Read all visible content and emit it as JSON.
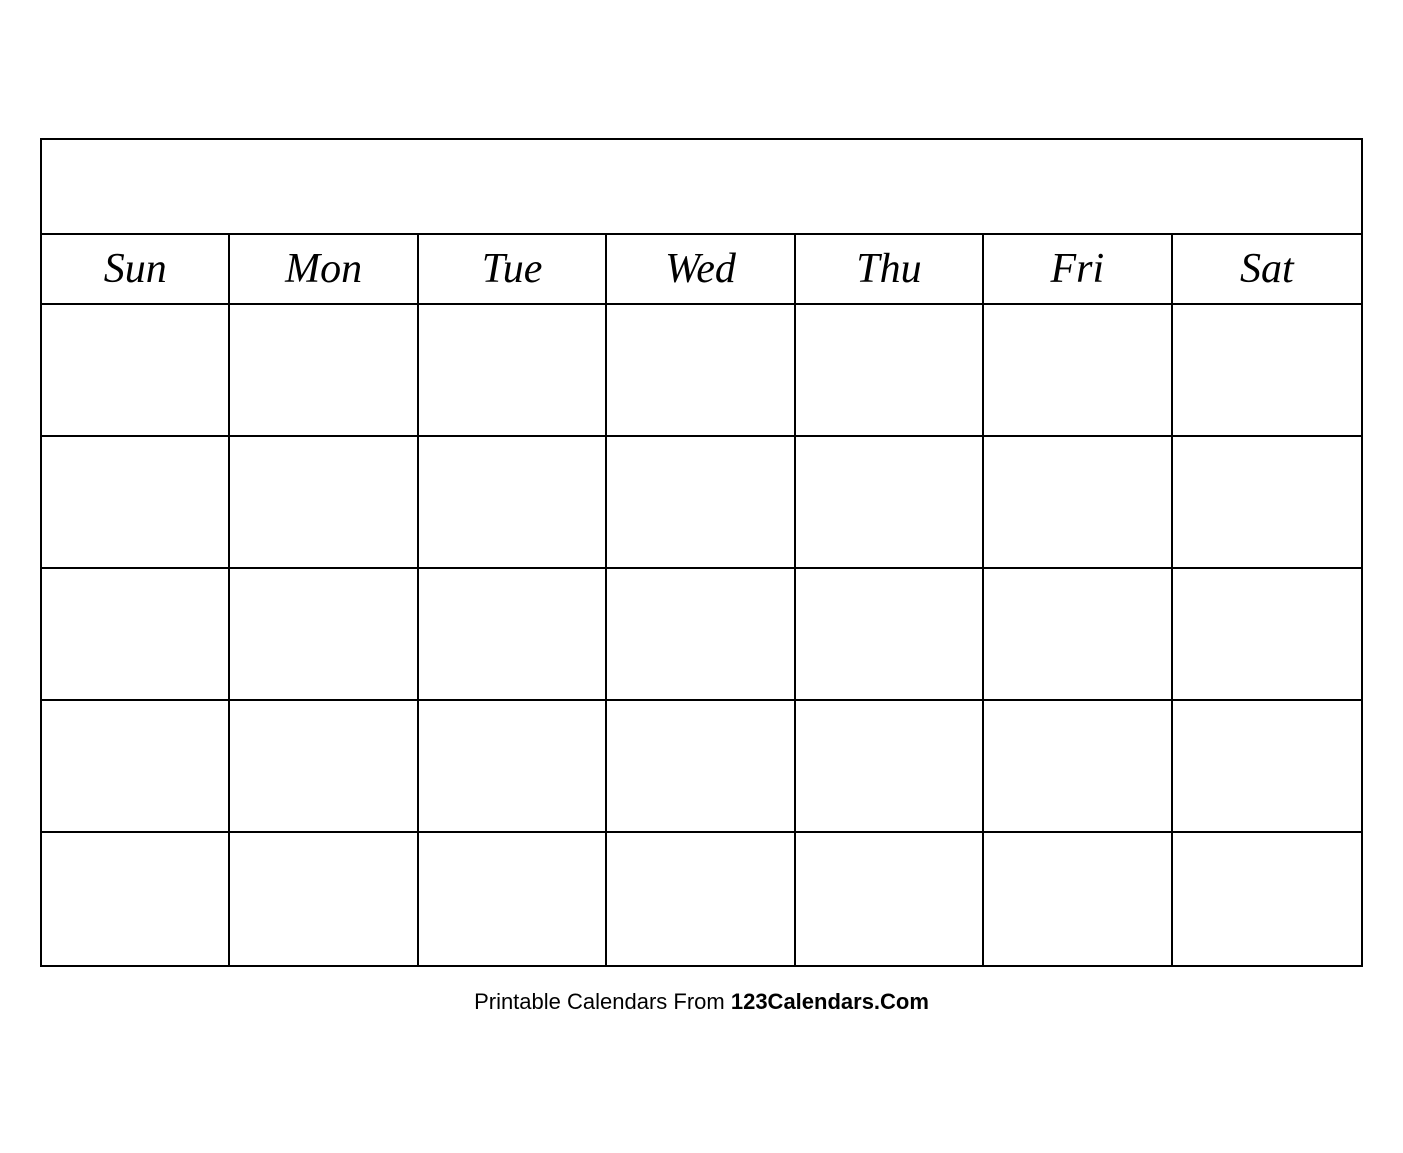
{
  "calendar": {
    "title": "",
    "days": [
      "Sun",
      "Mon",
      "Tue",
      "Wed",
      "Thu",
      "Fri",
      "Sat"
    ],
    "weeks": 5
  },
  "footer": {
    "text_regular": "Printable Calendars From ",
    "text_bold": "123Calendars.Com"
  }
}
